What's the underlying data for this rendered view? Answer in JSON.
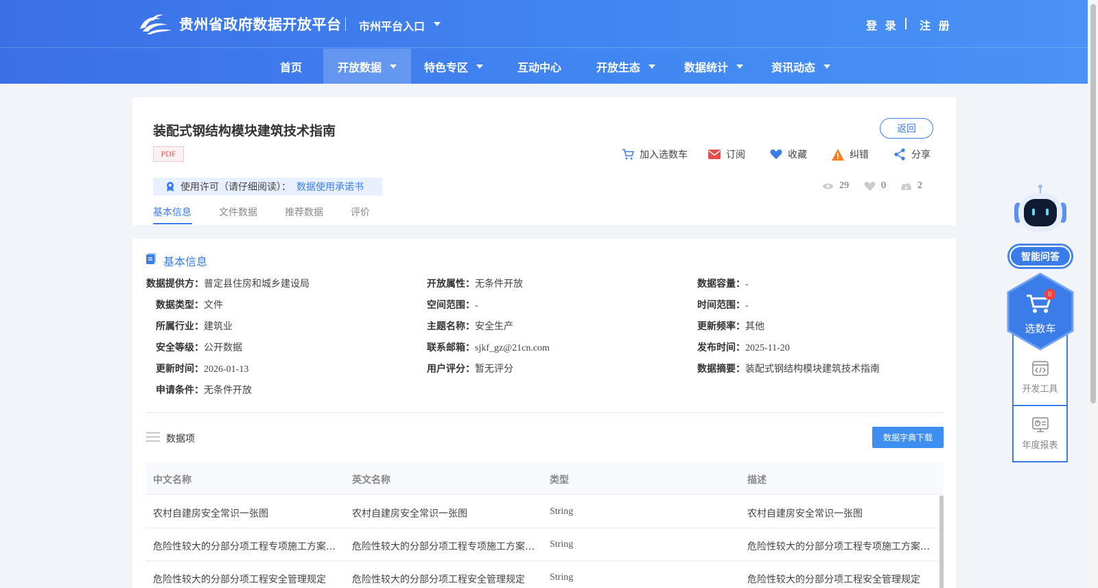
{
  "header": {
    "site_title": "贵州省政府数据开放平台",
    "city_entry": "市州平台入口",
    "login": "登 录",
    "register": "注 册"
  },
  "nav": {
    "items": [
      {
        "label": "首页"
      },
      {
        "label": "开放数据"
      },
      {
        "label": "特色专区"
      },
      {
        "label": "互动中心"
      },
      {
        "label": "开放生态"
      },
      {
        "label": "数据统计"
      },
      {
        "label": "资讯动态"
      }
    ]
  },
  "dataset": {
    "title": "装配式钢结构模块建筑技术指南",
    "format_tag": "PDF",
    "back_label": "返回",
    "actions": {
      "add_cart": "加入选数车",
      "subscribe": "订阅",
      "favorite": "收藏",
      "correct": "纠错",
      "share": "分享"
    },
    "stats": {
      "views": "29",
      "likes": "0",
      "downloads": "2"
    },
    "license_label": "使用许可（请仔细阅读）：",
    "license_link": "数据使用承诺书"
  },
  "tabs": [
    "基本信息",
    "文件数据",
    "推荐数据",
    "评价"
  ],
  "basic_info": {
    "section_title": "基本信息",
    "fields": {
      "provider": {
        "label": "数据提供方：",
        "value": "普定县住房和城乡建设局"
      },
      "open_attr": {
        "label": "开放属性：",
        "value": "无条件开放"
      },
      "capacity": {
        "label": "数据容量：",
        "value": "-"
      },
      "data_type": {
        "label": "数据类型：",
        "value": "文件"
      },
      "space_range": {
        "label": "空间范围：",
        "value": "-"
      },
      "time_range": {
        "label": "时间范围：",
        "value": "-"
      },
      "industry": {
        "label": "所属行业：",
        "value": "建筑业"
      },
      "topic": {
        "label": "主题名称：",
        "value": "安全生产"
      },
      "frequency": {
        "label": "更新频率：",
        "value": "其他"
      },
      "security": {
        "label": "安全等级：",
        "value": "公开数据"
      },
      "email": {
        "label": "联系邮箱：",
        "value": "sjkf_gz@21cn.com"
      },
      "publish_time": {
        "label": "发布时间：",
        "value": "2025-11-20"
      },
      "update_time": {
        "label": "更新时间：",
        "value": "2026-01-13"
      },
      "rating": {
        "label": "用户评分：",
        "value": "暂无评分"
      },
      "summary": {
        "label": "数据摘要：",
        "value": "装配式钢结构模块建筑技术指南"
      },
      "condition": {
        "label": "申请条件：",
        "value": "无条件开放"
      }
    }
  },
  "data_items": {
    "title": "数据项",
    "download_label": "数据字典下载",
    "columns": [
      "中文名称",
      "英文名称",
      "类型",
      "描述"
    ],
    "rows": [
      [
        "农村自建房安全常识一张图",
        "农村自建房安全常识一张图",
        "String",
        "农村自建房安全常识一张图"
      ],
      [
        "危险性较大的分部分项工程专项施工方案…",
        "危险性较大的分部分项工程专项施工方案…",
        "String",
        "危险性较大的分部分项工程专项施工方案…"
      ],
      [
        "危险性较大的分部分项工程安全管理规定",
        "危险性较大的分部分项工程安全管理规定",
        "String",
        "危险性较大的分部分项工程安全管理规定"
      ]
    ]
  },
  "sidebar": {
    "ai_label": "智能问答",
    "cart_label": "选数车",
    "cart_count": "0",
    "dev_tools": "开发工具",
    "annual_report": "年度报表"
  }
}
